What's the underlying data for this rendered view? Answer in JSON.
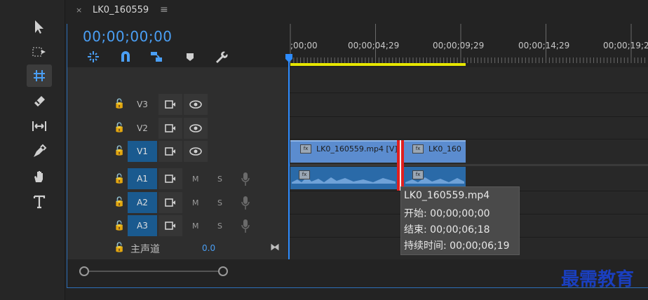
{
  "tab": {
    "close": "×",
    "title": "LK0_160559",
    "menu": "≡"
  },
  "timecode": "00;00;00;00",
  "ruler": {
    "labels": [
      ";00;00",
      "00;00;04;29",
      "00;00;09;29",
      "00;00;14;29",
      "00;00;19;2"
    ]
  },
  "tracks": {
    "video": [
      {
        "name": "V3",
        "on": false
      },
      {
        "name": "V2",
        "on": false
      },
      {
        "name": "V1",
        "on": true
      }
    ],
    "audio": [
      {
        "name": "A1",
        "m": "M",
        "s": "S"
      },
      {
        "name": "A2",
        "m": "M",
        "s": "S"
      },
      {
        "name": "A3",
        "m": "M",
        "s": "S"
      }
    ],
    "master": {
      "label": "主声道",
      "value": "0.0"
    }
  },
  "clips": {
    "fx": "fx",
    "video_1": "LK0_160559.mp4 [V]",
    "video_2": "LK0_160"
  },
  "tooltip": {
    "name": "LK0_160559.mp4",
    "start": "开始: 00;00;00;00",
    "end": "结束: 00;00;06;18",
    "duration": "持续时间: 00;00;06;19"
  },
  "watermark": "最需教育",
  "colors": {
    "accent": "#4a9ff5",
    "cut": "#e02020",
    "workarea": "#e6e600"
  }
}
